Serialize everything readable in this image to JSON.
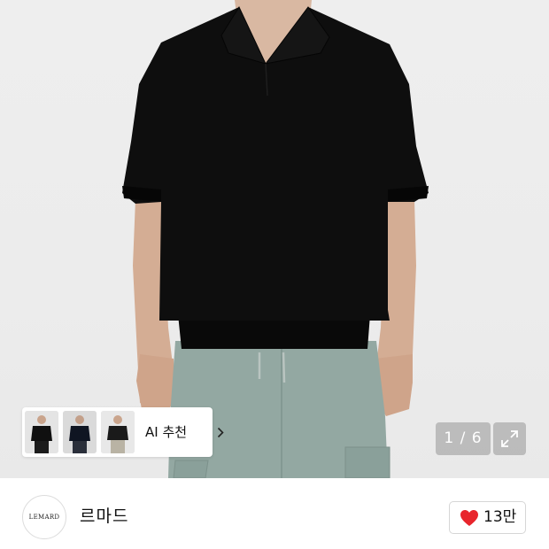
{
  "gallery": {
    "counter": "1 / 6",
    "ai_recommend_label": "AI 추천",
    "thumbnail_count": 3
  },
  "seller": {
    "logo_text": "LEMARD",
    "name": "르마드",
    "like_count": "13만"
  },
  "colors": {
    "heart": "#e8252c",
    "shirt": "#0d0d0d",
    "shorts": "#93a8a2"
  },
  "icons": [
    "chevron-right-icon",
    "expand-icon",
    "heart-icon"
  ]
}
